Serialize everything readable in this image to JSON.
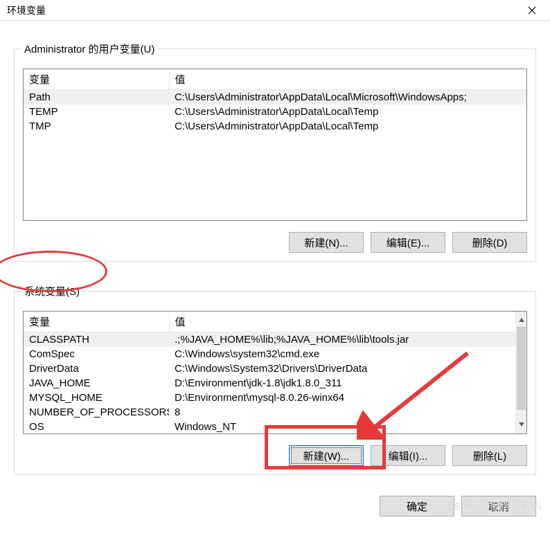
{
  "window": {
    "title": "环境变量"
  },
  "user_group": {
    "legend": "Administrator 的用户变量(U)",
    "headers": {
      "var": "变量",
      "val": "值"
    },
    "rows": [
      {
        "var": "Path",
        "val": "C:\\Users\\Administrator\\AppData\\Local\\Microsoft\\WindowsApps;"
      },
      {
        "var": "TEMP",
        "val": "C:\\Users\\Administrator\\AppData\\Local\\Temp"
      },
      {
        "var": "TMP",
        "val": "C:\\Users\\Administrator\\AppData\\Local\\Temp"
      }
    ],
    "buttons": {
      "new": "新建(N)...",
      "edit": "编辑(E)...",
      "delete": "删除(D)"
    }
  },
  "sys_group": {
    "legend": "系统变量(S)",
    "headers": {
      "var": "变量",
      "val": "值"
    },
    "rows": [
      {
        "var": "CLASSPATH",
        "val": ".;%JAVA_HOME%\\lib;%JAVA_HOME%\\lib\\tools.jar"
      },
      {
        "var": "ComSpec",
        "val": "C:\\Windows\\system32\\cmd.exe"
      },
      {
        "var": "DriverData",
        "val": "C:\\Windows\\System32\\Drivers\\DriverData"
      },
      {
        "var": "JAVA_HOME",
        "val": "D:\\Environment\\jdk-1.8\\jdk1.8.0_311"
      },
      {
        "var": "MYSQL_HOME",
        "val": "D:\\Environment\\mysql-8.0.26-winx64"
      },
      {
        "var": "NUMBER_OF_PROCESSORS",
        "val": "8"
      },
      {
        "var": "OS",
        "val": "Windows_NT"
      }
    ],
    "buttons": {
      "new": "新建(W)...",
      "edit": "编辑(I)...",
      "delete": "删除(L)"
    }
  },
  "dialog_buttons": {
    "ok": "确定",
    "cancel": "取消"
  },
  "watermark": "CSDN @智商三岁半i"
}
